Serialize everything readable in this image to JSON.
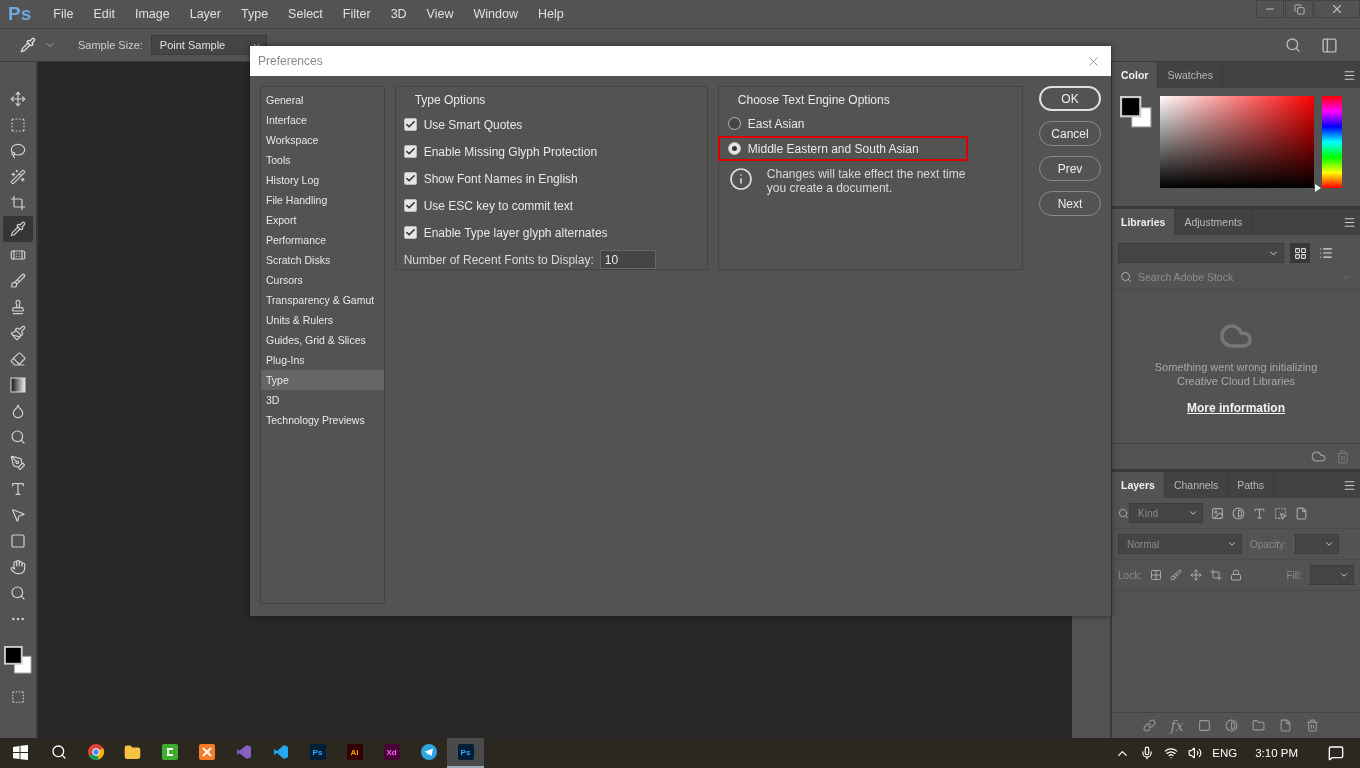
{
  "app": {
    "logo": "Ps"
  },
  "menu": [
    "File",
    "Edit",
    "Image",
    "Layer",
    "Type",
    "Select",
    "Filter",
    "3D",
    "View",
    "Window",
    "Help"
  ],
  "options_bar": {
    "sample_size_label": "Sample Size:",
    "sample_size": "Point Sample"
  },
  "tools": [
    {
      "kind": "move",
      "selected": false
    },
    {
      "kind": "marquee",
      "selected": false
    },
    {
      "kind": "lasso",
      "selected": false
    },
    {
      "kind": "quick-select",
      "selected": false
    },
    {
      "kind": "crop",
      "selected": false
    },
    {
      "kind": "eyedropper",
      "selected": true
    },
    {
      "kind": "healing",
      "selected": false
    },
    {
      "kind": "brush",
      "selected": false
    },
    {
      "kind": "stamp",
      "selected": false
    },
    {
      "kind": "history-brush",
      "selected": false
    },
    {
      "kind": "eraser",
      "selected": false
    },
    {
      "kind": "gradient",
      "selected": false
    },
    {
      "kind": "blur",
      "selected": false
    },
    {
      "kind": "dodge",
      "selected": false
    },
    {
      "kind": "pen",
      "selected": false
    },
    {
      "kind": "type",
      "selected": false
    },
    {
      "kind": "path-select",
      "selected": false
    },
    {
      "kind": "rectangle",
      "selected": false
    },
    {
      "kind": "hand",
      "selected": false
    },
    {
      "kind": "zoom",
      "selected": false
    },
    {
      "kind": "more",
      "selected": false
    }
  ],
  "dialog": {
    "title": "Preferences",
    "categories": [
      {
        "label": "General",
        "selected": false
      },
      {
        "label": "Interface",
        "selected": false
      },
      {
        "label": "Workspace",
        "selected": false
      },
      {
        "label": "Tools",
        "selected": false
      },
      {
        "label": "History Log",
        "selected": false
      },
      {
        "label": "File Handling",
        "selected": false
      },
      {
        "label": "Export",
        "selected": false
      },
      {
        "label": "Performance",
        "selected": false
      },
      {
        "label": "Scratch Disks",
        "selected": false
      },
      {
        "label": "Cursors",
        "selected": false
      },
      {
        "label": "Transparency & Gamut",
        "selected": false
      },
      {
        "label": "Units & Rulers",
        "selected": false
      },
      {
        "label": "Guides, Grid & Slices",
        "selected": false
      },
      {
        "label": "Plug-Ins",
        "selected": false
      },
      {
        "label": "Type",
        "selected": true
      },
      {
        "label": "3D",
        "selected": false
      },
      {
        "label": "Technology Previews",
        "selected": false
      }
    ],
    "type_options": {
      "title": "Type Options",
      "checkboxes": [
        {
          "label": "Use Smart Quotes",
          "checked": true
        },
        {
          "label": "Enable Missing Glyph Protection",
          "checked": true
        },
        {
          "label": "Show Font Names in English",
          "checked": true
        },
        {
          "label": "Use ESC key to commit text",
          "checked": true
        },
        {
          "label": "Enable Type layer glyph alternates",
          "checked": true
        }
      ],
      "recent_fonts": {
        "label": "Number of Recent Fonts to Display:",
        "value": "10"
      }
    },
    "text_engine": {
      "title": "Choose Text Engine Options",
      "options": [
        {
          "label": "East Asian",
          "selected": false,
          "highlighted": false
        },
        {
          "label": "Middle Eastern and South Asian",
          "selected": true,
          "highlighted": true
        }
      ],
      "note": [
        "Changes will take effect the next time",
        "you create a document."
      ]
    },
    "buttons": [
      "OK",
      "Cancel",
      "Prev",
      "Next"
    ]
  },
  "color_panel": {
    "tabs": [
      {
        "label": "Color",
        "selected": true
      },
      {
        "label": "Swatches",
        "selected": false
      }
    ],
    "hue": {
      "level": 0
    }
  },
  "libraries_panel": {
    "tabs": [
      {
        "label": "Libraries",
        "selected": true
      },
      {
        "label": "Adjustments",
        "selected": false
      }
    ],
    "search": {
      "placeholder": "Search Adobe Stock"
    },
    "message": [
      "Something went wrong initializing",
      "Creative Cloud Libraries"
    ],
    "link": "More information"
  },
  "layers_panel": {
    "tabs": [
      {
        "label": "Layers",
        "selected": true
      },
      {
        "label": "Channels",
        "selected": false
      },
      {
        "label": "Paths",
        "selected": false
      }
    ],
    "filter": {
      "placeholder": "Kind"
    },
    "blend_mode": "Normal",
    "opacity_label": "Opacity:",
    "lock_label": "Lock:",
    "fill_label": "Fill:",
    "fx": "fx"
  },
  "taskbar": {
    "apps": [
      {
        "kind": "chrome",
        "selected": false
      },
      {
        "kind": "folder",
        "selected": false
      },
      {
        "kind": "camtasia",
        "selected": false
      },
      {
        "kind": "xampp",
        "selected": false
      },
      {
        "kind": "visual-studio",
        "selected": false
      },
      {
        "kind": "vscode",
        "selected": false
      },
      {
        "kind": "photoshop",
        "text": "Ps",
        "selected": false
      },
      {
        "kind": "illustrator",
        "text": "Ai",
        "selected": false
      },
      {
        "kind": "xd",
        "text": "Xd",
        "selected": false
      },
      {
        "kind": "telegram",
        "selected": false
      },
      {
        "kind": "photoshop",
        "text": "Ps",
        "selected": true
      }
    ],
    "language": "ENG",
    "time": "3:10 PM"
  }
}
